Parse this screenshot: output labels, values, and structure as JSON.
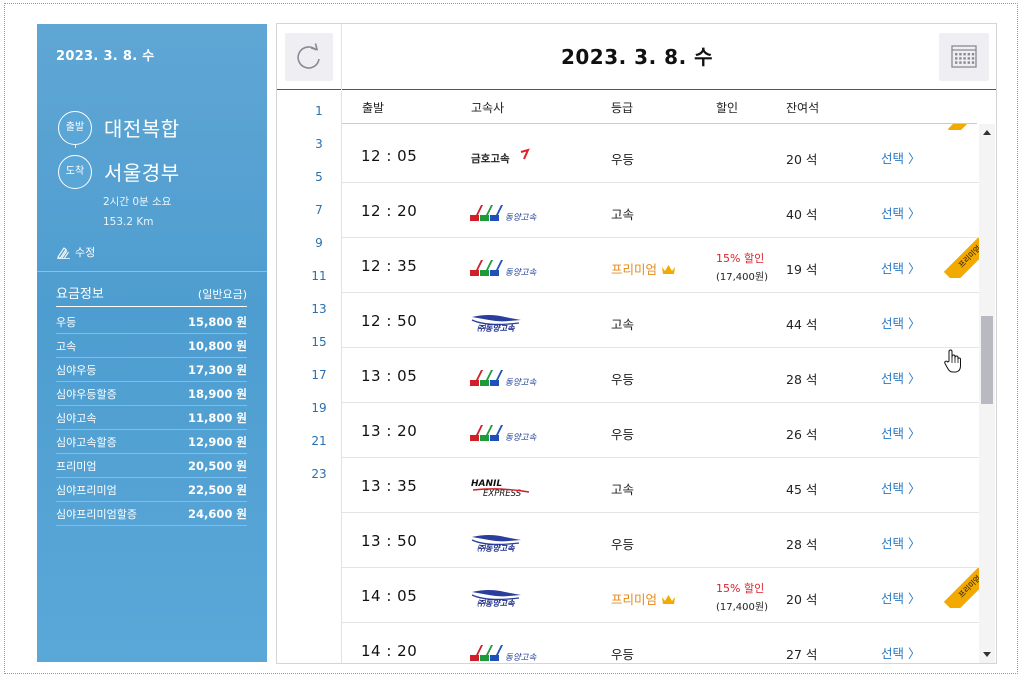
{
  "left": {
    "date": "2023. 3. 8. 수",
    "departure_tag": "출발",
    "departure": "대전복합",
    "arrival_tag": "도착",
    "arrival": "서울경부",
    "duration": "2시간 0분 소요",
    "distance": "153.2 Km",
    "edit_label": "수정",
    "fare_title": "요금정보",
    "fare_subtitle": "(일반요금)",
    "fares": [
      {
        "name": "우등",
        "price": "15,800 원"
      },
      {
        "name": "고속",
        "price": "10,800 원"
      },
      {
        "name": "심야우등",
        "price": "17,300 원"
      },
      {
        "name": "심야우등할증",
        "price": "18,900 원"
      },
      {
        "name": "심야고속",
        "price": "11,800 원"
      },
      {
        "name": "심야고속할증",
        "price": "12,900 원"
      },
      {
        "name": "프리미엄",
        "price": "20,500 원"
      },
      {
        "name": "심야프리미엄",
        "price": "22,500 원"
      },
      {
        "name": "심야프리미엄할증",
        "price": "24,600 원"
      }
    ]
  },
  "header": {
    "date": "2023. 3. 8. 수",
    "refresh_icon": "refresh-icon",
    "calendar_icon": "calendar-icon"
  },
  "hours": [
    "1",
    "3",
    "5",
    "7",
    "9",
    "11",
    "13",
    "15",
    "17",
    "19",
    "21",
    "23"
  ],
  "columns": {
    "departure": "출발",
    "company": "고속사",
    "grade": "등급",
    "discount": "할인",
    "seats": "잔여석"
  },
  "ribbon_label": "프리미엄",
  "rows": [
    {
      "time": "12 : 05",
      "company": "금호고속",
      "logo": "kumho",
      "grade": "우등",
      "premium": false,
      "discount": "",
      "discount_price": "",
      "seats": "20 석",
      "select": "선택 〉"
    },
    {
      "time": "12 : 20",
      "company": "동양고속",
      "logo": "dongyang",
      "grade": "고속",
      "premium": false,
      "discount": "",
      "discount_price": "",
      "seats": "40 석",
      "select": "선택 〉"
    },
    {
      "time": "12 : 35",
      "company": "동양고속",
      "logo": "dongyang",
      "grade": "프리미엄",
      "premium": true,
      "discount": "15% 할인",
      "discount_price": "(17,400원)",
      "seats": "19 석",
      "select": "선택 〉"
    },
    {
      "time": "12 : 50",
      "company": "동양고속",
      "logo": "dongyang-bus",
      "grade": "고속",
      "premium": false,
      "discount": "",
      "discount_price": "",
      "seats": "44 석",
      "select": "선택 〉"
    },
    {
      "time": "13 : 05",
      "company": "동양고속",
      "logo": "dongyang",
      "grade": "우등",
      "premium": false,
      "discount": "",
      "discount_price": "",
      "seats": "28 석",
      "select": "선택 〉"
    },
    {
      "time": "13 : 20",
      "company": "동양고속",
      "logo": "dongyang",
      "grade": "우등",
      "premium": false,
      "discount": "",
      "discount_price": "",
      "seats": "26 석",
      "select": "선택 〉"
    },
    {
      "time": "13 : 35",
      "company": "HANIL EXPRESS",
      "logo": "hanil",
      "grade": "고속",
      "premium": false,
      "discount": "",
      "discount_price": "",
      "seats": "45 석",
      "select": "선택 〉"
    },
    {
      "time": "13 : 50",
      "company": "동양고속",
      "logo": "dongyang-bus",
      "grade": "우등",
      "premium": false,
      "discount": "",
      "discount_price": "",
      "seats": "28 석",
      "select": "선택 〉"
    },
    {
      "time": "14 : 05",
      "company": "동양고속",
      "logo": "dongyang-bus",
      "grade": "프리미엄",
      "premium": true,
      "discount": "15% 할인",
      "discount_price": "(17,400원)",
      "seats": "20 석",
      "select": "선택 〉"
    },
    {
      "time": "14 : 20",
      "company": "동양고속",
      "logo": "dongyang",
      "grade": "우등",
      "premium": false,
      "discount": "",
      "discount_price": "",
      "seats": "27 석",
      "select": "선택 〉"
    }
  ],
  "colors": {
    "panel_blue": "#55a2d3",
    "link_blue": "#2a78c4",
    "premium_orange": "#e58a1b",
    "discount_red": "#d9232d",
    "ribbon_yellow": "#f2a900"
  }
}
